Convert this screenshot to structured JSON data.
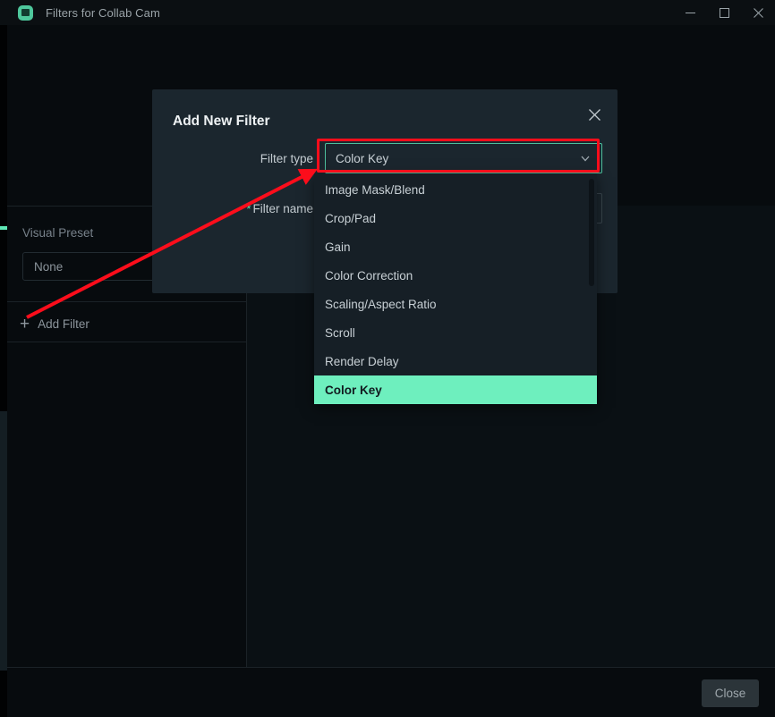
{
  "window": {
    "title": "Filters for Collab Cam",
    "app_icon": "camera-app-icon",
    "controls": {
      "minimize": "minimize-icon",
      "maximize": "maximize-icon",
      "close": "close-icon"
    }
  },
  "left_panel": {
    "visual_preset_label": "Visual Preset",
    "visual_preset_value": "None",
    "add_filter_label": "Add Filter",
    "add_filter_icon": "plus-icon"
  },
  "footer": {
    "close_label": "Close"
  },
  "modal": {
    "title": "Add New Filter",
    "close_icon": "close-icon",
    "filter_type_label": "Filter type",
    "filter_type_value": "Color Key",
    "filter_name_label": "Filter name",
    "filter_name_required_marker": "*",
    "filter_name_value": "",
    "filter_name_placeholder": "",
    "chevron_icon": "chevron-down-icon"
  },
  "dropdown": {
    "open": true,
    "selected": "Color Key",
    "options": [
      "Image Mask/Blend",
      "Crop/Pad",
      "Gain",
      "Color Correction",
      "Scaling/Aspect Ratio",
      "Scroll",
      "Render Delay",
      "Color Key"
    ]
  },
  "annotations": {
    "highlight_color": "#fc0d1b",
    "arrow_color": "#fc0d1b",
    "highlight_target": "filter-type-select",
    "arrow_from": "add-filter-button",
    "arrow_to": "filter-type-dropdown"
  },
  "colors": {
    "accent": "#6eefbe",
    "dialog_bg": "#1b262e",
    "window_bg": "#070b0e",
    "titlebar_bg": "#0b0f12"
  }
}
